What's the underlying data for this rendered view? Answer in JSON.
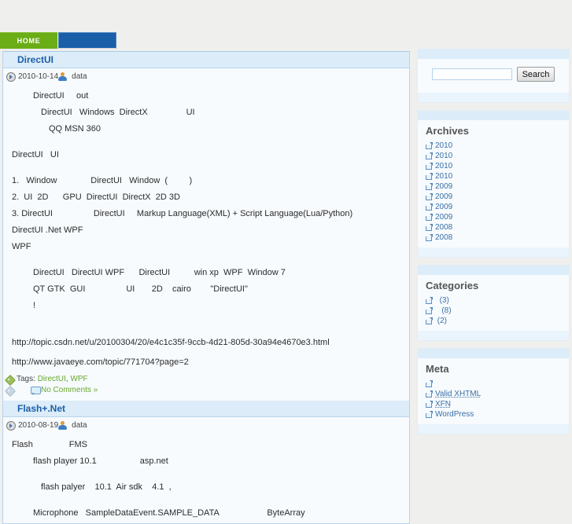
{
  "nav": {
    "items": [
      {
        "label": "HOME",
        "name": "nav-home",
        "color": "#6aad16"
      },
      {
        "label": "",
        "name": "nav-second",
        "color": "#1a5fa8"
      }
    ]
  },
  "posts": [
    {
      "title": "DirectUI",
      "date": "2010-10-14",
      "author": "data",
      "lines": [
        {
          "indent": 1,
          "text": "DirectUI     out"
        },
        {
          "indent": 0,
          "text": ""
        },
        {
          "indent": 2,
          "text": "DirectUI   Windows  DirectX                UI"
        },
        {
          "indent": 0,
          "text": ""
        },
        {
          "indent": 3,
          "text": "QQ MSN 360"
        },
        {
          "indent": 0,
          "text": ""
        },
        {
          "indent": 0,
          "text": "DirectUI   UI"
        },
        {
          "indent": 0,
          "text": ""
        },
        {
          "indent": 0,
          "text": "1.   Window              DirectUI   Window  (         )"
        },
        {
          "indent": 0,
          "text": "2.  UI  2D      GPU  DirectUI  DirectX  2D 3D"
        },
        {
          "indent": 0,
          "text": "3. DirectUI                 DirectUI     Markup Language(XML) + Script Language(Lua/Python)"
        },
        {
          "indent": 0,
          "text": ""
        },
        {
          "indent": 0,
          "text": "DirectUI .Net WPF"
        },
        {
          "indent": 0,
          "text": "WPF"
        },
        {
          "indent": 0,
          "text": ""
        },
        {
          "indent": 1,
          "text": "DirectUI   DirectUI WPF      DirectUI          win xp  WPF  Window 7"
        },
        {
          "indent": 0,
          "text": ""
        },
        {
          "indent": 1,
          "text": "QT GTK  GUI                 UI       2D    cairo        \"DirectUI\""
        },
        {
          "indent": 1,
          "text": "!"
        }
      ],
      "urls": [
        "http://topic.csdn.net/u/20100304/20/e4c1c35f-9ccb-4d21-805d-30a94e4670e3.html",
        "http://www.javaeye.com/topic/771704?page=2"
      ],
      "tags_label": "Tags:",
      "tags": [
        "DirectUI",
        "WPF"
      ],
      "comments": "No Comments »"
    },
    {
      "title": "Flash+.Net",
      "date": "2010-08-19",
      "author": "data",
      "lines": [
        {
          "indent": 0,
          "text": "Flash               FMS"
        },
        {
          "indent": 1,
          "text": "flash player 10.1                  asp.net"
        },
        {
          "indent": 0,
          "text": ""
        },
        {
          "indent": 2,
          "text": "flash palyer    10.1  Air sdk    4.1  ,"
        },
        {
          "indent": 0,
          "text": ""
        },
        {
          "indent": 1,
          "text": "Microphone   SampleDataEvent.SAMPLE_DATA                    ByteArray"
        }
      ],
      "urls": [],
      "tags_label": "",
      "tags": [],
      "comments": ""
    }
  ],
  "sidebar": {
    "search": {
      "value": "",
      "placeholder": "",
      "button_label": "Search"
    },
    "archives": {
      "title": "Archives",
      "items": [
        "2010",
        "2010",
        "2010",
        "2010",
        "2009",
        "2009",
        "2009",
        "2009",
        "2008",
        "2008"
      ]
    },
    "categories": {
      "title": "Categories",
      "items": [
        {
          "label": "",
          "count": "(3)"
        },
        {
          "label": "",
          "count": "(8)"
        },
        {
          "label": "",
          "count": "(2)"
        }
      ]
    },
    "meta": {
      "title": "Meta",
      "items": [
        "",
        "Valid XHTML",
        "XFN",
        "WordPress"
      ]
    }
  }
}
